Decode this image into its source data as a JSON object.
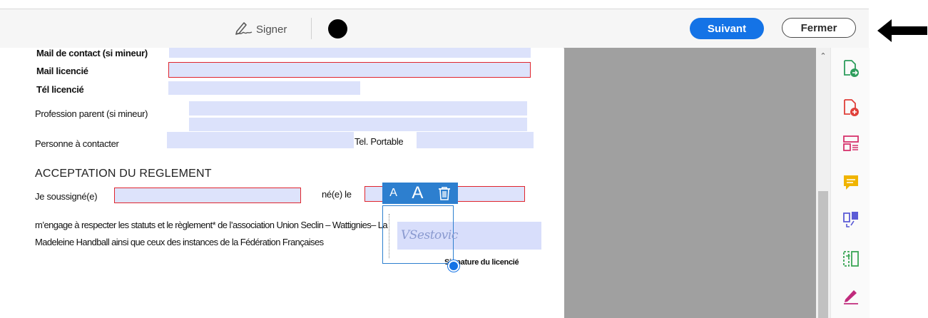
{
  "toolbar": {
    "sign_label": "Signer",
    "next_label": "Suivant",
    "close_label": "Fermer",
    "ink_color": "#000000",
    "accent_color": "#1473e6"
  },
  "form": {
    "mail_contact_label": "Mail de contact (si mineur)",
    "mail_licencie_label": "Mail licencié",
    "tel_licencie_label": "Tél licencié",
    "profession_label": "Profession parent (si mineur)",
    "personne_label": "Personne à contacter",
    "tel_portable_label": "Tel. Portable",
    "section_heading": "ACCEPTATION DU REGLEMENT",
    "soussigne_label": "Je soussigné(e)",
    "ne_le_label": "né(e) le",
    "paragraph_line1": "m’engage à respecter les statuts et le règlement* de l’association Union Seclin – Wattignies– La",
    "paragraph_line2": "Madeleine Handball ainsi que ceux des instances de la Fédération Françaises",
    "signature_label": "Signature du licencié"
  },
  "signature": {
    "text": "VSestovic",
    "tool_small_label": "A",
    "tool_large_label": "A"
  },
  "side_tools": [
    "export-pdf-icon",
    "create-pdf-icon",
    "organize-pages-icon",
    "comment-icon",
    "combine-files-icon",
    "compress-icon",
    "fill-sign-icon"
  ]
}
